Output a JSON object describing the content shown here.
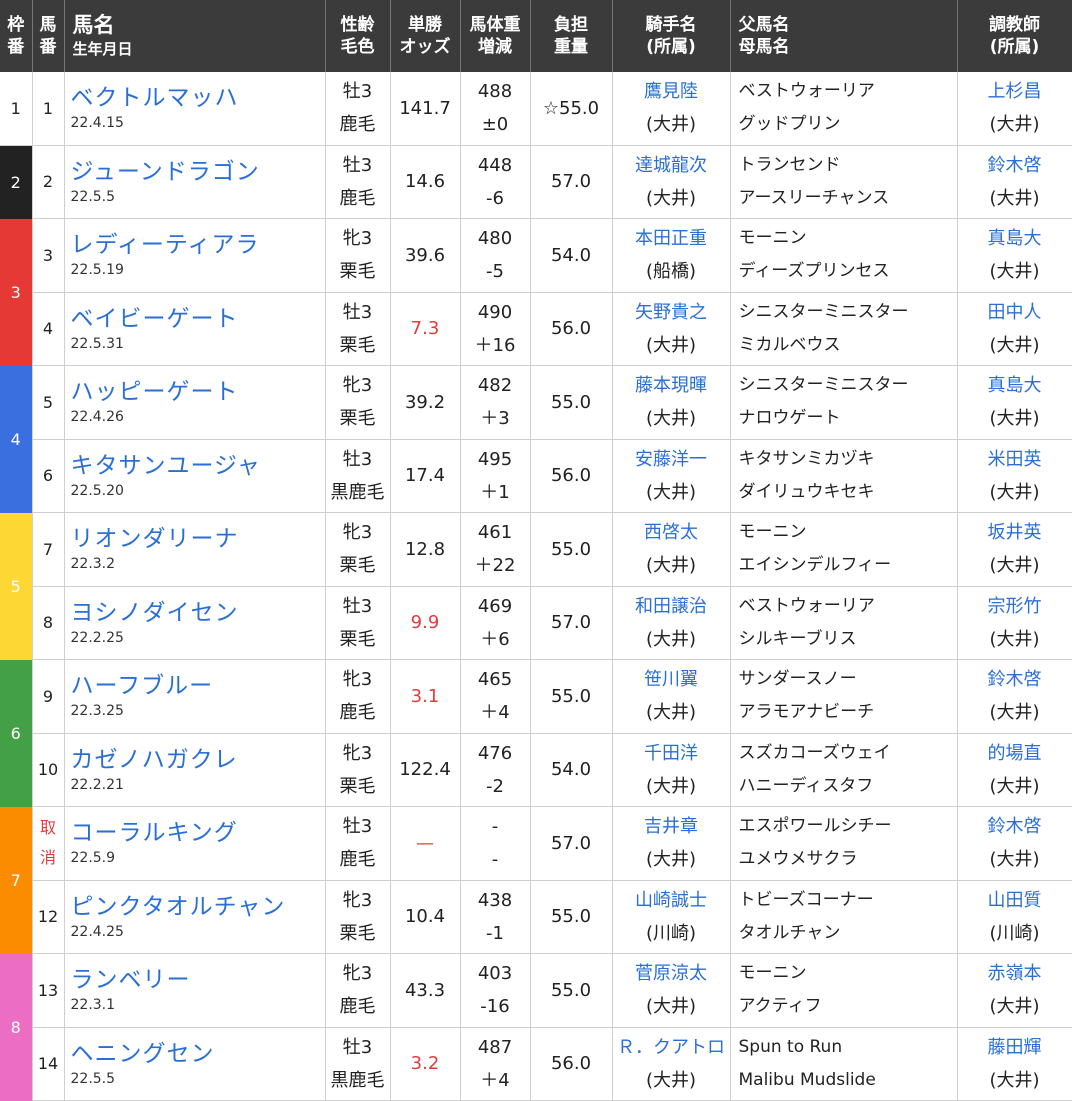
{
  "headers": {
    "waku": "枠番",
    "umaban": "馬番",
    "name": "馬名",
    "birth": "生年月日",
    "sex_age": "性齢",
    "coat": "毛色",
    "odds1": "単勝",
    "odds2": "オッズ",
    "weight1": "馬体重",
    "weight2": "増減",
    "burden1": "負担",
    "burden2": "重量",
    "jockey1": "騎手名",
    "jockey2": "(所属)",
    "sire": "父馬名",
    "dam": "母馬名",
    "trainer1": "調教師",
    "trainer2": "(所属)"
  },
  "waku_colors": {
    "1": "#ffffff",
    "2": "#222222",
    "3": "#e53935",
    "4": "#3a6fe0",
    "5": "#fdd835",
    "6": "#43a047",
    "7": "#fb8c00",
    "8": "#ec6ec4"
  },
  "rows": [
    {
      "waku": "1",
      "num": "1",
      "name": "ベクトルマッハ",
      "birth": "22.4.15",
      "sex": "牡3",
      "coat": "鹿毛",
      "odds": "141.7",
      "hot": false,
      "weight": "488",
      "diff": "±0",
      "burden": "☆55.0",
      "jockey": "鷹見陸",
      "jaff": "(大井)",
      "sire": "ベストウォーリア",
      "dam": "グッドプリン",
      "trainer": "上杉昌",
      "taff": "(大井)"
    },
    {
      "waku": "2",
      "num": "2",
      "name": "ジューンドラゴン",
      "birth": "22.5.5",
      "sex": "牡3",
      "coat": "鹿毛",
      "odds": "14.6",
      "hot": false,
      "weight": "448",
      "diff": "-6",
      "burden": "57.0",
      "jockey": "達城龍次",
      "jaff": "(大井)",
      "sire": "トランセンド",
      "dam": "アースリーチャンス",
      "trainer": "鈴木啓",
      "taff": "(大井)"
    },
    {
      "waku": "3",
      "num": "3",
      "name": "レディーティアラ",
      "birth": "22.5.19",
      "sex": "牝3",
      "coat": "栗毛",
      "odds": "39.6",
      "hot": false,
      "weight": "480",
      "diff": "-5",
      "burden": "54.0",
      "jockey": "本田正重",
      "jaff": "(船橋)",
      "sire": "モーニン",
      "dam": "ディーズプリンセス",
      "trainer": "真島大",
      "taff": "(大井)"
    },
    {
      "waku": "3",
      "num": "4",
      "name": "ベイビーゲート",
      "birth": "22.5.31",
      "sex": "牡3",
      "coat": "栗毛",
      "odds": "7.3",
      "hot": true,
      "weight": "490",
      "diff": "＋16",
      "burden": "56.0",
      "jockey": "矢野貴之",
      "jaff": "(大井)",
      "sire": "シニスターミニスター",
      "dam": "ミカルベウス",
      "trainer": "田中人",
      "taff": "(大井)"
    },
    {
      "waku": "4",
      "num": "5",
      "name": "ハッピーゲート",
      "birth": "22.4.26",
      "sex": "牝3",
      "coat": "栗毛",
      "odds": "39.2",
      "hot": false,
      "weight": "482",
      "diff": "＋3",
      "burden": "55.0",
      "jockey": "藤本現暉",
      "jaff": "(大井)",
      "sire": "シニスターミニスター",
      "dam": "ナロウゲート",
      "trainer": "真島大",
      "taff": "(大井)"
    },
    {
      "waku": "4",
      "num": "6",
      "name": "キタサンユージャ",
      "birth": "22.5.20",
      "sex": "牡3",
      "coat": "黒鹿毛",
      "odds": "17.4",
      "hot": false,
      "weight": "495",
      "diff": "＋1",
      "burden": "56.0",
      "jockey": "安藤洋一",
      "jaff": "(大井)",
      "sire": "キタサンミカヅキ",
      "dam": "ダイリュウキセキ",
      "trainer": "米田英",
      "taff": "(大井)"
    },
    {
      "waku": "5",
      "num": "7",
      "name": "リオンダリーナ",
      "birth": "22.3.2",
      "sex": "牝3",
      "coat": "栗毛",
      "odds": "12.8",
      "hot": false,
      "weight": "461",
      "diff": "＋22",
      "burden": "55.0",
      "jockey": "西啓太",
      "jaff": "(大井)",
      "sire": "モーニン",
      "dam": "エイシンデルフィー",
      "trainer": "坂井英",
      "taff": "(大井)"
    },
    {
      "waku": "5",
      "num": "8",
      "name": "ヨシノダイセン",
      "birth": "22.2.25",
      "sex": "牡3",
      "coat": "栗毛",
      "odds": "9.9",
      "hot": true,
      "weight": "469",
      "diff": "＋6",
      "burden": "57.0",
      "jockey": "和田譲治",
      "jaff": "(大井)",
      "sire": "ベストウォーリア",
      "dam": "シルキーブリス",
      "trainer": "宗形竹",
      "taff": "(大井)"
    },
    {
      "waku": "6",
      "num": "9",
      "name": "ハーフブルー",
      "birth": "22.3.25",
      "sex": "牝3",
      "coat": "鹿毛",
      "odds": "3.1",
      "hot": true,
      "weight": "465",
      "diff": "＋4",
      "burden": "55.0",
      "jockey": "笹川翼",
      "jaff": "(大井)",
      "sire": "サンダースノー",
      "dam": "アラモアナビーチ",
      "trainer": "鈴木啓",
      "taff": "(大井)"
    },
    {
      "waku": "6",
      "num": "10",
      "name": "カゼノハガクレ",
      "birth": "22.2.21",
      "sex": "牝3",
      "coat": "栗毛",
      "odds": "122.4",
      "hot": false,
      "weight": "476",
      "diff": "-2",
      "burden": "54.0",
      "jockey": "千田洋",
      "jaff": "(大井)",
      "sire": "スズカコーズウェイ",
      "dam": "ハニーディスタフ",
      "trainer": "的場直",
      "taff": "(大井)"
    },
    {
      "waku": "7",
      "num": "取消",
      "name": "コーラルキング",
      "birth": "22.5.9",
      "sex": "牡3",
      "coat": "鹿毛",
      "odds": "—",
      "hot": true,
      "weight": "-",
      "diff": "-",
      "burden": "57.0",
      "jockey": "吉井章",
      "jaff": "(大井)",
      "sire": "エスポワールシチー",
      "dam": "ユメウメサクラ",
      "trainer": "鈴木啓",
      "taff": "(大井)"
    },
    {
      "waku": "7",
      "num": "12",
      "name": "ピンクタオルチャン",
      "birth": "22.4.25",
      "sex": "牝3",
      "coat": "栗毛",
      "odds": "10.4",
      "hot": false,
      "weight": "438",
      "diff": "-1",
      "burden": "55.0",
      "jockey": "山崎誠士",
      "jaff": "(川崎)",
      "sire": "トビーズコーナー",
      "dam": "タオルチャン",
      "trainer": "山田質",
      "taff": "(川崎)"
    },
    {
      "waku": "8",
      "num": "13",
      "name": "ランベリー",
      "birth": "22.3.1",
      "sex": "牝3",
      "coat": "鹿毛",
      "odds": "43.3",
      "hot": false,
      "weight": "403",
      "diff": "-16",
      "burden": "55.0",
      "jockey": "菅原涼太",
      "jaff": "(大井)",
      "sire": "モーニン",
      "dam": "アクティフ",
      "trainer": "赤嶺本",
      "taff": "(大井)"
    },
    {
      "waku": "8",
      "num": "14",
      "name": "ヘニングセン",
      "birth": "22.5.5",
      "sex": "牡3",
      "coat": "黒鹿毛",
      "odds": "3.2",
      "hot": true,
      "weight": "487",
      "diff": "＋4",
      "burden": "56.0",
      "jockey": "Ｒ．クアトロ",
      "jaff": "(大井)",
      "sire": "Spun to Run",
      "dam": "Malibu Mudslide",
      "trainer": "藤田輝",
      "taff": "(大井)"
    }
  ]
}
